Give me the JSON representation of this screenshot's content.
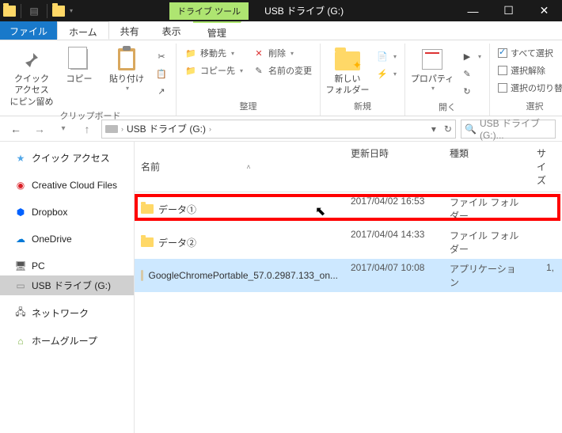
{
  "titlebar": {
    "tool_tab": "ドライブ ツール",
    "title": "USB ドライブ (G:)"
  },
  "tabs": {
    "file": "ファイル",
    "home": "ホーム",
    "share": "共有",
    "view": "表示",
    "manage": "管理"
  },
  "ribbon": {
    "clipboard": {
      "pin": "クイック アクセス\nにピン留め",
      "copy": "コピー",
      "paste": "貼り付け",
      "label": "クリップボード"
    },
    "organize": {
      "moveto": "移動先",
      "copyto": "コピー先",
      "delete": "削除",
      "rename": "名前の変更",
      "label": "整理"
    },
    "new": {
      "newfolder": "新しい\nフォルダー",
      "label": "新規"
    },
    "open": {
      "properties": "プロパティ",
      "label": "開く"
    },
    "select": {
      "selectall": "すべて選択",
      "selectnone": "選択解除",
      "invert": "選択の切り替え",
      "label": "選択"
    }
  },
  "address": {
    "segment": "USB ドライブ (G:)",
    "search_placeholder": "USB ドライブ (G:)..."
  },
  "nav": {
    "quickaccess": "クイック アクセス",
    "creativecloud": "Creative Cloud Files",
    "dropbox": "Dropbox",
    "onedrive": "OneDrive",
    "pc": "PC",
    "usbdrive": "USB ドライブ (G:)",
    "network": "ネットワーク",
    "homegroup": "ホームグループ"
  },
  "columns": {
    "name": "名前",
    "date": "更新日時",
    "type": "種類",
    "size": "サイズ"
  },
  "rows": [
    {
      "name": "データ①",
      "date": "2017/04/02 16:53",
      "type": "ファイル フォルダー",
      "size": "",
      "icon": "folder"
    },
    {
      "name": "データ②",
      "date": "2017/04/04 14:33",
      "type": "ファイル フォルダー",
      "size": "",
      "icon": "folder"
    },
    {
      "name": "GoogleChromePortable_57.0.2987.133_on...",
      "date": "2017/04/07 10:08",
      "type": "アプリケーション",
      "size": "1,",
      "icon": "exe",
      "selected": true
    }
  ]
}
